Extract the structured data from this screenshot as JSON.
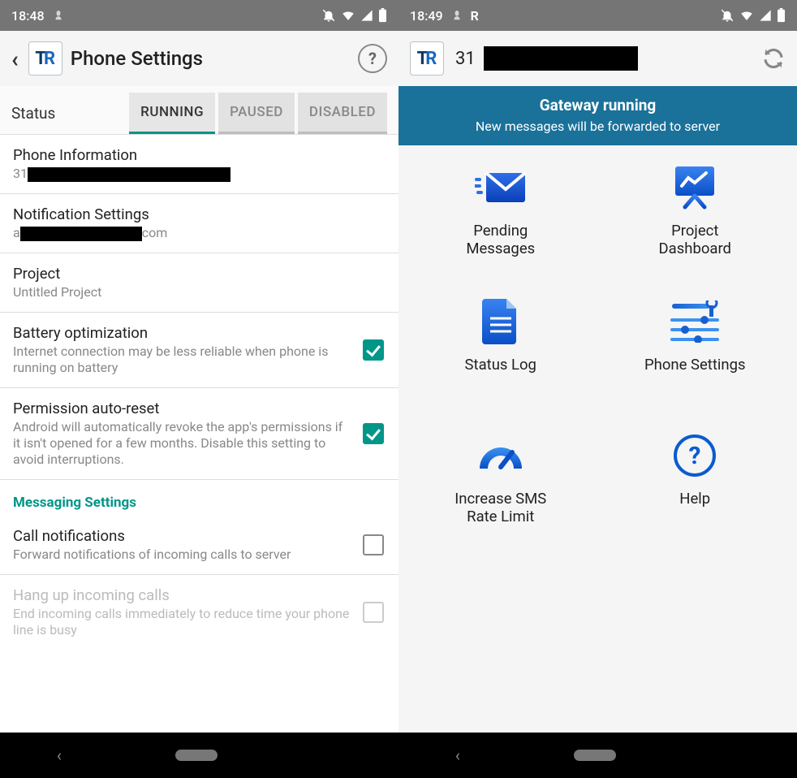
{
  "left": {
    "statusbar": {
      "time": "18:48"
    },
    "header": {
      "title": "Phone Settings",
      "help_label": "?"
    },
    "status_row": {
      "label": "Status",
      "tabs": [
        "RUNNING",
        "PAUSED",
        "DISABLED"
      ]
    },
    "items": {
      "phone_info": {
        "title": "Phone Information",
        "prefix": "31"
      },
      "notif": {
        "title": "Notification Settings",
        "prefix": "a",
        "suffix": "com"
      },
      "project": {
        "title": "Project",
        "value": "Untitled Project"
      },
      "battery": {
        "title": "Battery optimization",
        "desc": "Internet connection may be less reliable when phone is running on battery"
      },
      "perm": {
        "title": "Permission auto-reset",
        "desc": "Android will automatically revoke the app's permissions if it isn't opened for a few months. Disable this setting to avoid interruptions."
      },
      "section": "Messaging Settings",
      "callnotif": {
        "title": "Call notifications",
        "desc": "Forward notifications of incoming calls to server"
      },
      "hangup": {
        "title": "Hang up incoming calls",
        "desc": "End incoming calls immediately to reduce time your phone line is busy"
      }
    }
  },
  "right": {
    "statusbar": {
      "time": "18:49"
    },
    "header": {
      "prefix": "31"
    },
    "banner": {
      "line1": "Gateway running",
      "line2": "New messages will be forwarded to server"
    },
    "tiles": {
      "pending": "Pending Messages",
      "dashboard": "Project Dashboard",
      "log": "Status Log",
      "settings": "Phone Settings",
      "rate": "Increase SMS Rate Limit",
      "help": "Help"
    }
  }
}
